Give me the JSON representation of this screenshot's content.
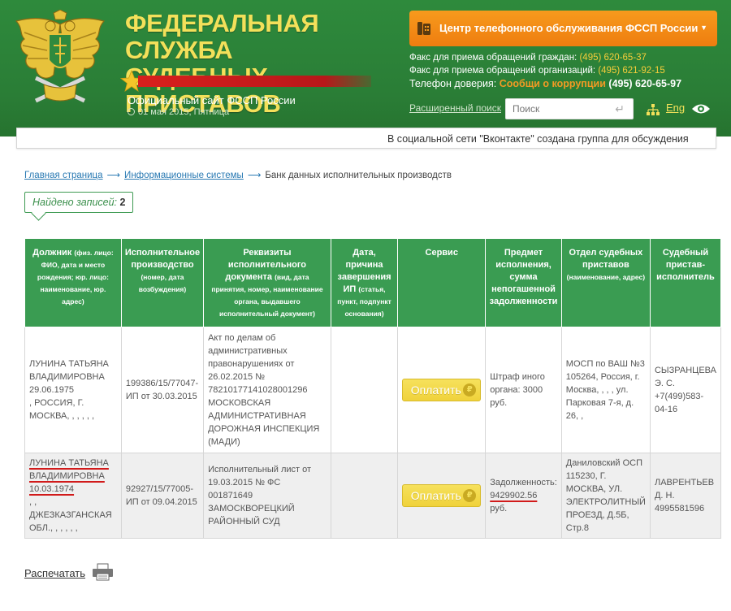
{
  "header": {
    "title_line1": "ФЕДЕРАЛЬНАЯ СЛУЖБА",
    "title_line2": "СУДЕБНЫХ ПРИСТАВОВ",
    "site_name": "Официальный сайт ФССП России",
    "date": "01 мая 2015, Пятница",
    "phone_center": "Центр телефонного обслуживания ФССП России",
    "fax_citizens_label": "Факс для приема обращений граждан:",
    "fax_citizens_num": "(495) 620-65-37",
    "fax_orgs_label": "Факс для приема обращений организаций:",
    "fax_orgs_num": "(495) 621-92-15",
    "hotline_label": "Телефон доверия:",
    "hotline_report": "Сообщи о коррупции",
    "hotline_num": "(495) 620-65-97",
    "advanced_search": "Расширенный поиск",
    "search_placeholder": "Поиск",
    "lang": "Eng"
  },
  "ticker": "В социальной сети \"Вконтакте\" создана группа для обсуждения",
  "breadcrumb": {
    "home": "Главная страница",
    "systems": "Информационные системы",
    "current": "Банк данных исполнительных производств"
  },
  "found": {
    "label": "Найдено записей:",
    "count": "2"
  },
  "table": {
    "headers": {
      "debtor": "Должник",
      "debtor_note": "(физ. лицо: ФИО, дата и место рождения; юр. лицо: наименование, юр. адрес)",
      "proceeding": "Исполнительное производство",
      "proceeding_note": "(номер, дата возбуждения)",
      "document": "Реквизиты исполнительного документа",
      "document_note": "(вид, дата принятия, номер, наименование органа, выдавшего исполнительный документ)",
      "end": "Дата, причина завершения ИП",
      "end_note": "(статья, пункт, подпункт основания)",
      "service": "Сервис",
      "subject": "Предмет исполнения, сумма непогашенной задолженности",
      "department": "Отдел судебных приставов",
      "department_note": "(наименование, адрес)",
      "bailiff": "Судебный пристав-исполнитель"
    },
    "pay_label": "Оплатить",
    "rub_symbol": "₽",
    "rows": [
      {
        "debtor_name": "ЛУНИНА ТАТЬЯНА ВЛАДИМИРОВНА",
        "debtor_dob": "29.06.1975",
        "debtor_place": ", РОССИЯ, Г. МОСКВА, , , , , ,",
        "proceeding": "199386/15/77047-ИП от 30.03.2015",
        "document": "Акт по делам об административных правонарушениях от 26.02.2015 № 78210177141028001296 МОСКОВСКАЯ АДМИНИСТРАТИВНАЯ ДОРОЖНАЯ ИНСПЕКЦИЯ (МАДИ)",
        "end": "",
        "subject_text": "Штраф иного органа: 3000 руб.",
        "department": "МОСП по ВАШ №3 105264, Россия, г. Москва, , , , ул. Парковая 7-я, д. 26, ,",
        "bailiff": "СЫЗРАНЦЕВА Э. С. +7(499)583-04-16"
      },
      {
        "debtor_name1": "ЛУНИНА ТАТЬЯНА",
        "debtor_name2": "ВЛАДИМИРОВНА",
        "debtor_dob": "10.03.1974",
        "debtor_place": ", , ДЖЕЗКАЗГАНСКАЯ ОБЛ., , , , , ,",
        "proceeding": "92927/15/77005-ИП от 09.04.2015",
        "document": "Исполнительный лист от 19.03.2015 № ФС 001871649 ЗАМОСКВОРЕЦКИЙ РАЙОННЫЙ СУД",
        "end": "",
        "subject_label": "Задолженность:",
        "subject_amount": "9429902.56",
        "subject_unit": "руб.",
        "department": "Даниловский ОСП 115230, Г. МОСКВА, УЛ. ЭЛЕКТРОЛИТНЫЙ ПРОЕЗД, Д.5Б, Стр.8",
        "bailiff": "ЛАВРЕНТЬЕВ Д. Н. 4995581596"
      }
    ]
  },
  "print_label": "Распечатать",
  "colors": {
    "header_green": "#2e8a3c",
    "title_yellow": "#f3e05a",
    "accent_orange": "#ee7d0f",
    "table_header": "#3a9c52",
    "pay_yellow": "#f0d23b",
    "underline_red": "#d11a1a"
  }
}
